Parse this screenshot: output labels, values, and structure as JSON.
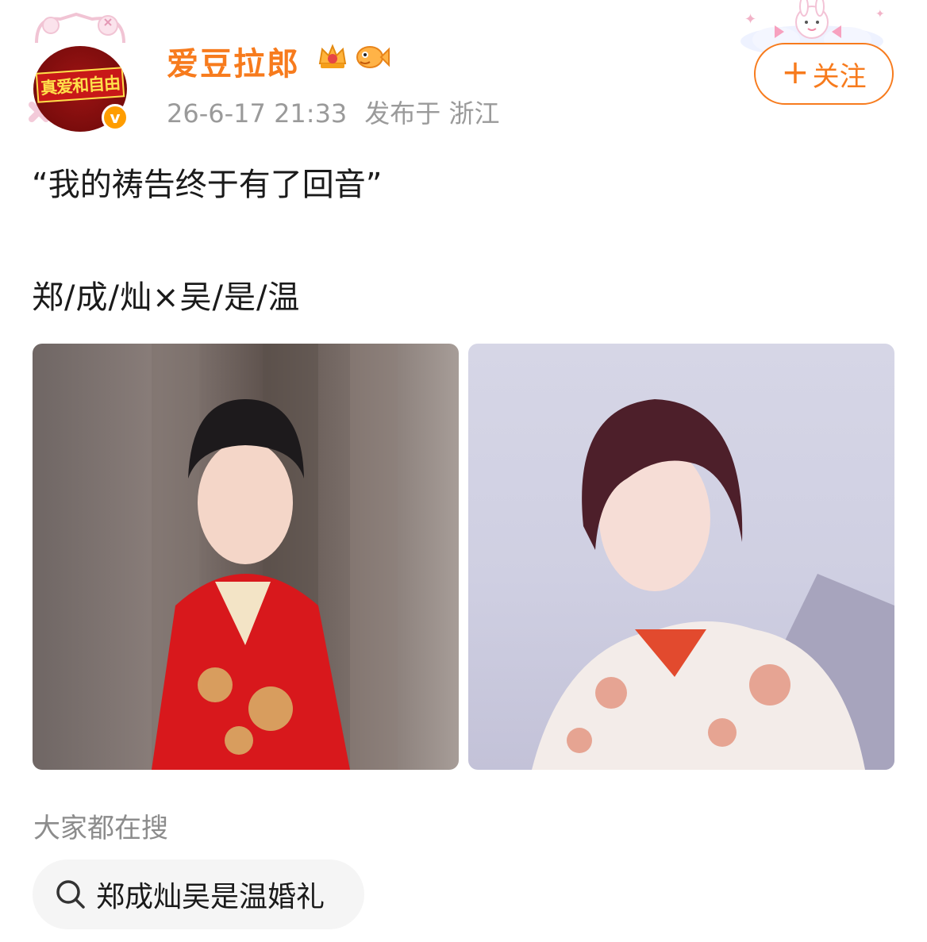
{
  "user": {
    "name": "爱豆拉郎",
    "avatar_text": "真爱和自由",
    "verified_glyph": "v",
    "timestamp": "26-6-17 21:33",
    "location": "发布于 浙江",
    "badges": [
      "crown-badge-icon",
      "fish-badge-icon"
    ]
  },
  "follow": {
    "plus": "+",
    "label": "关注"
  },
  "post": {
    "line1": "“我的祷告终于有了回音”",
    "line2": "郑/成/灿×吴/是/温",
    "images": [
      {
        "name": "photo-left",
        "alt": "red embroidered outfit portrait"
      },
      {
        "name": "photo-right",
        "alt": "white embroidered outfit portrait"
      }
    ]
  },
  "search": {
    "section_label": "大家都在搜",
    "chip_text": "郑成灿吴是温婚礼"
  },
  "colors": {
    "accent": "#f77b1d",
    "verified": "#ff9d00",
    "muted": "#9a9a9a",
    "chip_bg": "#f5f5f5"
  }
}
